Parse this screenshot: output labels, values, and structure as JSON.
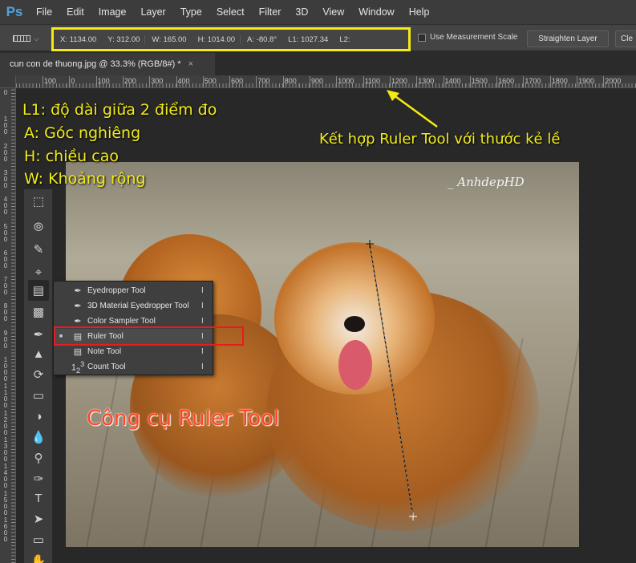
{
  "app": {
    "logo": "Ps"
  },
  "menu": [
    "File",
    "Edit",
    "Image",
    "Layer",
    "Type",
    "Select",
    "Filter",
    "3D",
    "View",
    "Window",
    "Help"
  ],
  "options": {
    "fields": [
      {
        "label": "X:",
        "value": "1134.00"
      },
      {
        "label": "Y:",
        "value": "312.00"
      },
      {
        "label": "W:",
        "value": "165.00"
      },
      {
        "label": "H:",
        "value": "1014.00"
      },
      {
        "label": "A:",
        "value": "-80.8°"
      },
      {
        "label": "L1:",
        "value": "1027.34"
      },
      {
        "label": "L2:",
        "value": ""
      }
    ],
    "use_measurement_scale": "Use Measurement Scale",
    "straighten": "Straighten Layer",
    "clear": "Cle"
  },
  "document": {
    "tab_title": "cun con de thuong.jpg @ 33.3% (RGB/8#) *",
    "close": "×"
  },
  "ruler": {
    "h_labels": [
      "100",
      "0",
      "100",
      "200",
      "300",
      "400",
      "500",
      "600",
      "700",
      "800",
      "900",
      "1000",
      "1100",
      "1200",
      "1300",
      "1400",
      "1500",
      "1600",
      "1700",
      "1800",
      "1900",
      "2000"
    ],
    "v_labels": [
      "0",
      "100",
      "200",
      "300",
      "400",
      "500",
      "600",
      "700",
      "800",
      "900",
      "1000",
      "1100",
      "1200",
      "1300",
      "1400",
      "1500",
      "1600"
    ]
  },
  "annotations": {
    "l1": "L1: độ dài giữa 2 điểm đo",
    "a": "A: Góc nghiêng",
    "h": "H: chiều cao",
    "w": "W: Khoảng rộng",
    "ruler_combo": "Kết hợp Ruler Tool với thước kẻ lề",
    "tool_caption": "Công cụ Ruler Tool",
    "watermark": "_ AnhdepHD"
  },
  "flyout": [
    {
      "label": "Eyedropper Tool",
      "key": "I",
      "icon": "eyedropper-icon"
    },
    {
      "label": "3D Material Eyedropper Tool",
      "key": "I",
      "icon": "3d-eyedropper-icon"
    },
    {
      "label": "Color Sampler Tool",
      "key": "I",
      "icon": "color-sampler-icon"
    },
    {
      "label": "Ruler Tool",
      "key": "I",
      "icon": "ruler-icon",
      "selected": true
    },
    {
      "label": "Note Tool",
      "key": "I",
      "icon": "note-icon"
    },
    {
      "label": "Count Tool",
      "key": "I",
      "icon": "count-icon"
    }
  ],
  "colors": {
    "highlight_yellow": "#f5ea14",
    "highlight_red": "#e61d1d",
    "ps_blue": "#4fa3e0"
  }
}
